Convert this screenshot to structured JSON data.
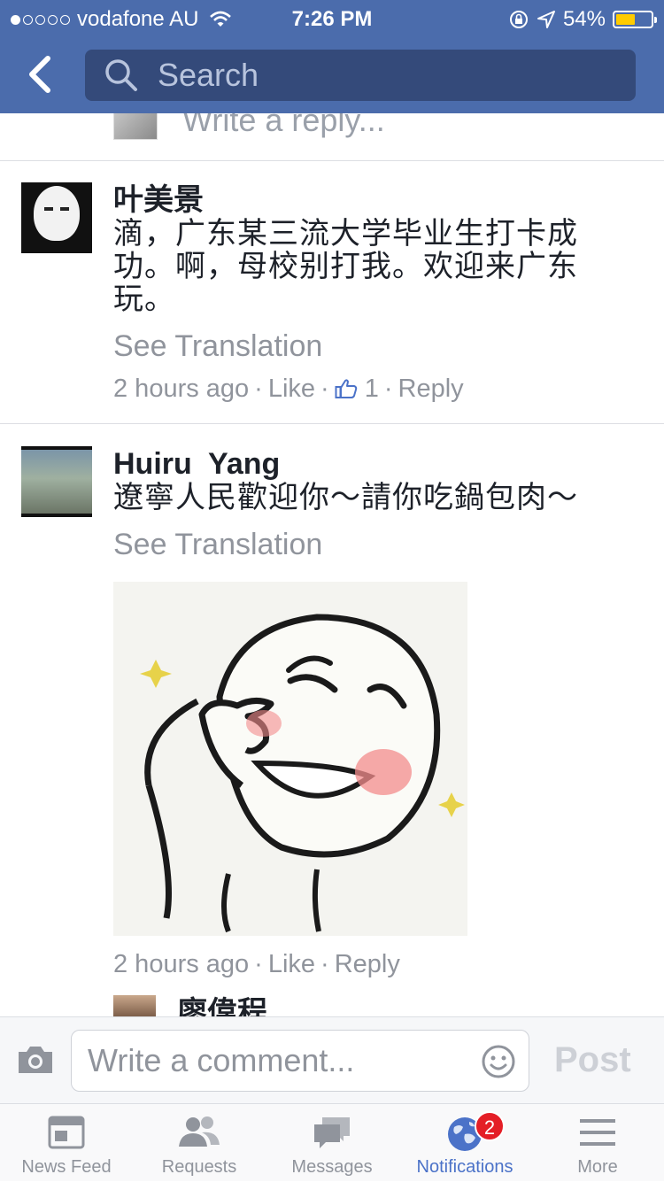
{
  "status_bar": {
    "carrier": "vodafone AU",
    "time": "7:26 PM",
    "battery": "54%",
    "battery_level": 0.54,
    "signal_bars_filled": 1,
    "signal_bars_total": 5
  },
  "header": {
    "search_placeholder": "Search"
  },
  "reply_box_partial": {
    "placeholder": "Write a reply..."
  },
  "comments": [
    {
      "name": "叶美景",
      "text_lines": [
        "滴，广东某三流大学毕业生打卡成",
        "功。啊，母校别打我。欢迎来广东",
        "玩。"
      ],
      "see_translation": "See Translation",
      "time": "2 hours ago",
      "like_label": "Like",
      "like_count": "1",
      "reply_label": "Reply"
    },
    {
      "name": "Huiru  Yang",
      "text_lines": [
        "遼寧人民歡迎你～請你吃鍋包肉～"
      ],
      "see_translation": "See Translation",
      "time": "2 hours ago",
      "like_label": "Like",
      "reply_label": "Reply"
    }
  ],
  "next_commenter": {
    "name": "廖偉程"
  },
  "composer": {
    "placeholder": "Write a comment...",
    "post_label": "Post"
  },
  "tabs": [
    {
      "label": "News Feed",
      "icon": "news-feed-icon"
    },
    {
      "label": "Requests",
      "icon": "friend-requests-icon"
    },
    {
      "label": "Messages",
      "icon": "messages-icon"
    },
    {
      "label": "Notifications",
      "icon": "globe-icon",
      "badge": "2",
      "active": true
    },
    {
      "label": "More",
      "icon": "menu-icon"
    }
  ],
  "colors": {
    "header_blue": "#4b6cac",
    "search_bg": "#344a7a",
    "meta_gray": "#90949c",
    "active_tab": "#4b72c8",
    "badge_red": "#e41e26",
    "battery_yellow": "#ffcc00"
  }
}
